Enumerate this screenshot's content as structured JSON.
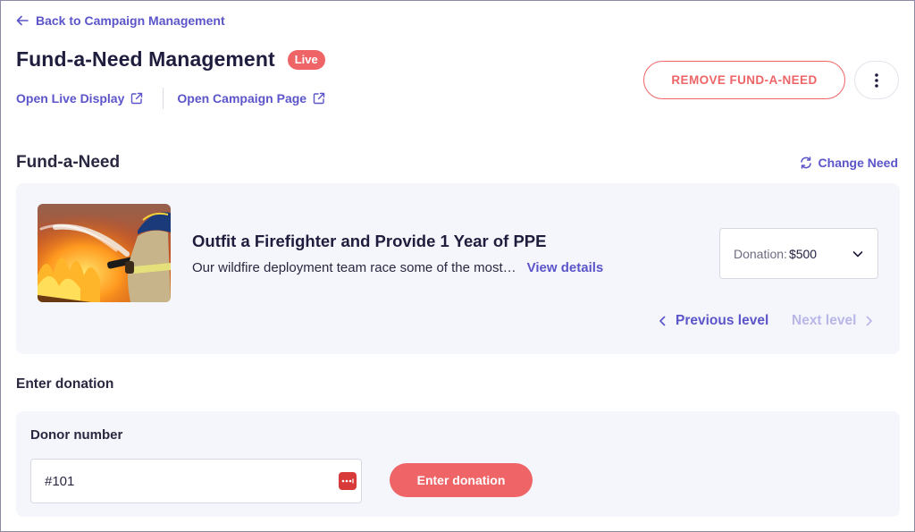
{
  "nav": {
    "back_label": "Back to Campaign Management"
  },
  "header": {
    "title": "Fund-a-Need Management",
    "status_badge": "Live",
    "links": [
      {
        "label": "Open Live Display",
        "icon": "external-link-icon"
      },
      {
        "label": "Open Campaign Page",
        "icon": "external-link-icon"
      }
    ],
    "remove_button": "REMOVE FUND-A-NEED",
    "more_icon": "more-vertical-icon"
  },
  "need_section": {
    "title": "Fund-a-Need",
    "change_label": "Change Need",
    "change_icon": "refresh-icon",
    "card": {
      "image_icon": "firefighter-photo",
      "title": "Outfit a Firefighter and Provide 1 Year of PPE",
      "description": "Our wildfire deployment team race some of the most…",
      "view_details": "View details",
      "donation_label": "Donation:",
      "donation_value": "$500",
      "prev_label": "Previous level",
      "next_label": "Next level"
    }
  },
  "enter_donation": {
    "heading": "Enter donation",
    "donor_label": "Donor number",
    "donor_value": "#101",
    "submit_label": "Enter donation"
  },
  "colors": {
    "accent": "#5b55c9",
    "danger": "#ee6467",
    "disabled": "#b9b6e8",
    "card_bg": "#f5f6fb",
    "text": "#1f1d3d"
  }
}
